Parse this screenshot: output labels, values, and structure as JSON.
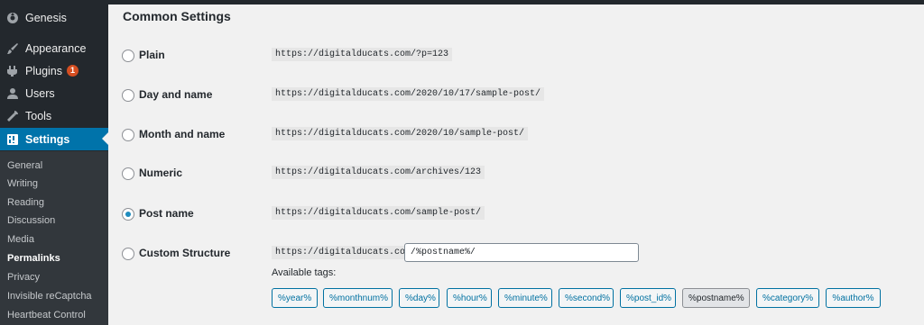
{
  "sidebar": {
    "top_item": {
      "label": "Genesis",
      "icon": "genesis-icon"
    },
    "menu": [
      {
        "label": "Appearance",
        "icon": "paintbrush-icon"
      },
      {
        "label": "Plugins",
        "icon": "plugin-icon",
        "badge": "1"
      },
      {
        "label": "Users",
        "icon": "user-icon"
      },
      {
        "label": "Tools",
        "icon": "wrench-icon"
      },
      {
        "label": "Settings",
        "icon": "settings-icon",
        "active": true
      }
    ],
    "submenu": [
      {
        "label": "General"
      },
      {
        "label": "Writing"
      },
      {
        "label": "Reading"
      },
      {
        "label": "Discussion"
      },
      {
        "label": "Media"
      },
      {
        "label": "Permalinks",
        "current": true
      },
      {
        "label": "Privacy"
      },
      {
        "label": "Invisible reCaptcha"
      },
      {
        "label": "Heartbeat Control"
      }
    ]
  },
  "main": {
    "section_title": "Common Settings",
    "options": [
      {
        "label": "Plain",
        "example": "https://digitalducats.com/?p=123",
        "checked": false
      },
      {
        "label": "Day and name",
        "example": "https://digitalducats.com/2020/10/17/sample-post/",
        "checked": false
      },
      {
        "label": "Month and name",
        "example": "https://digitalducats.com/2020/10/sample-post/",
        "checked": false
      },
      {
        "label": "Numeric",
        "example": "https://digitalducats.com/archives/123",
        "checked": false
      },
      {
        "label": "Post name",
        "example": "https://digitalducats.com/sample-post/",
        "checked": true
      },
      {
        "label": "Custom Structure",
        "example": "https://digitalducats.com",
        "checked": false
      }
    ],
    "custom_structure_value": "/%postname%/",
    "available_tags_label": "Available tags:",
    "tags": [
      "%year%",
      "%monthnum%",
      "%day%",
      "%hour%",
      "%minute%",
      "%second%",
      "%post_id%",
      "%postname%",
      "%category%",
      "%author%"
    ],
    "pressed_tag": "%postname%"
  },
  "colors": {
    "sidebar_bg": "#23282d",
    "submenu_bg": "#32373c",
    "accent": "#0073aa",
    "badge": "#d54e21",
    "radio_checked": "#1e8cbe",
    "page_bg": "#f1f1f1"
  }
}
